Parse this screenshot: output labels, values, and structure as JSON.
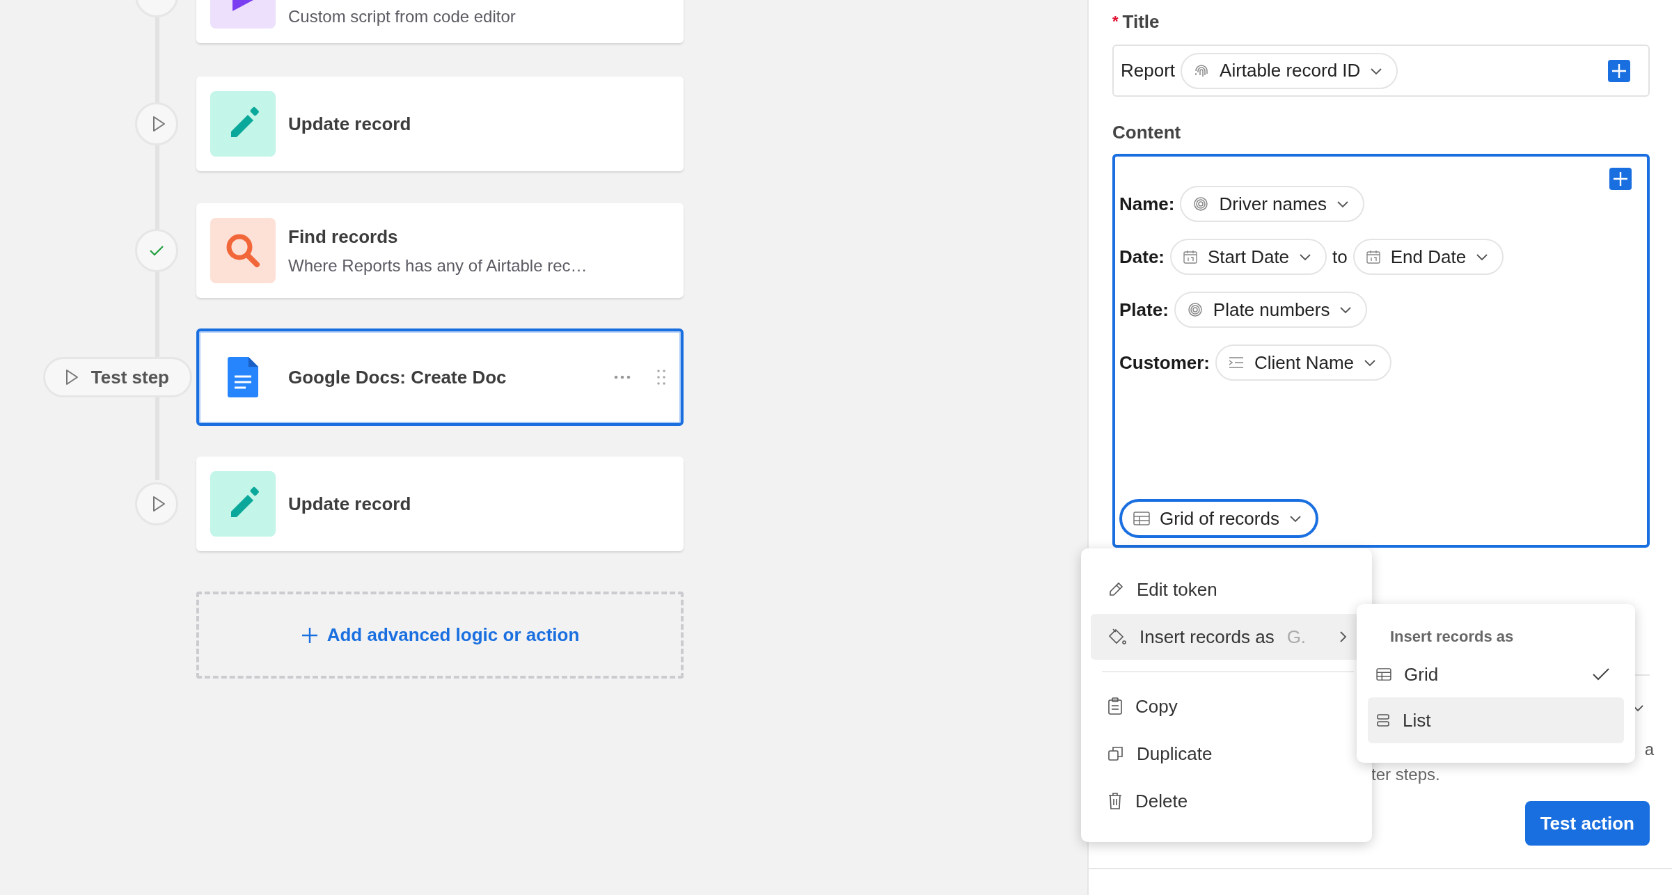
{
  "flow": {
    "steps": [
      {
        "kind": "script",
        "subtitle": "Custom script from code editor",
        "marker": {
          "kind": "cut"
        },
        "selected": false
      },
      {
        "kind": "update",
        "title": "Update record",
        "marker": {
          "kind": "play"
        },
        "selected": false
      },
      {
        "kind": "find",
        "title": "Find records",
        "subtitle": "Where Reports has any of Airtable rec…",
        "marker": {
          "kind": "done"
        },
        "selected": false
      },
      {
        "kind": "docs",
        "title": "Google Docs: Create Doc",
        "marker": {
          "kind": "test",
          "label": "Test step"
        },
        "selected": true
      },
      {
        "kind": "update",
        "title": "Update record",
        "marker": {
          "kind": "play"
        },
        "selected": false
      }
    ],
    "add_button": {
      "label": "Add advanced logic or action"
    }
  },
  "panel": {
    "title_field": {
      "label": "Title",
      "required_mark": "*",
      "parts": [
        {
          "kind": "text",
          "text": "Report"
        },
        {
          "kind": "id",
          "label": "Airtable record ID"
        }
      ]
    },
    "content_field": {
      "label": "Content",
      "lines": [
        {
          "label": "Name:",
          "parts": [
            {
              "kind": "lookup",
              "label": "Driver names"
            }
          ]
        },
        {
          "label": "Date:",
          "parts": [
            {
              "kind": "date",
              "label": "Start Date"
            },
            {
              "kind": "text",
              "text": "to"
            },
            {
              "kind": "date",
              "label": "End Date"
            }
          ]
        },
        {
          "label": "Plate:",
          "parts": [
            {
              "kind": "lookup",
              "label": "Plate numbers"
            }
          ]
        },
        {
          "label": "Customer:",
          "parts": [
            {
              "kind": "textfield",
              "label": "Client Name"
            }
          ]
        }
      ],
      "records_token": {
        "kind": "records",
        "label": "Grid of records",
        "active": true
      }
    },
    "hidden_texts": [
      "a",
      "ter steps."
    ],
    "test_button": "Test action"
  },
  "context_menu": {
    "groups": [
      [
        {
          "kind": "edit",
          "label": "Edit token",
          "highlighted": false
        },
        {
          "kind": "format",
          "label": "Insert records as",
          "value": "G.",
          "submenu": true,
          "highlighted": true
        }
      ],
      [
        {
          "kind": "copy",
          "label": "Copy",
          "highlighted": false
        },
        {
          "kind": "duplicate",
          "label": "Duplicate",
          "highlighted": false
        },
        {
          "kind": "delete",
          "label": "Delete",
          "highlighted": false
        }
      ]
    ],
    "submenu": {
      "heading": "Insert records as",
      "options": [
        {
          "kind": "grid",
          "label": "Grid",
          "checked": true,
          "highlighted": false
        },
        {
          "kind": "list",
          "label": "List",
          "checked": false,
          "highlighted": true
        }
      ]
    }
  }
}
